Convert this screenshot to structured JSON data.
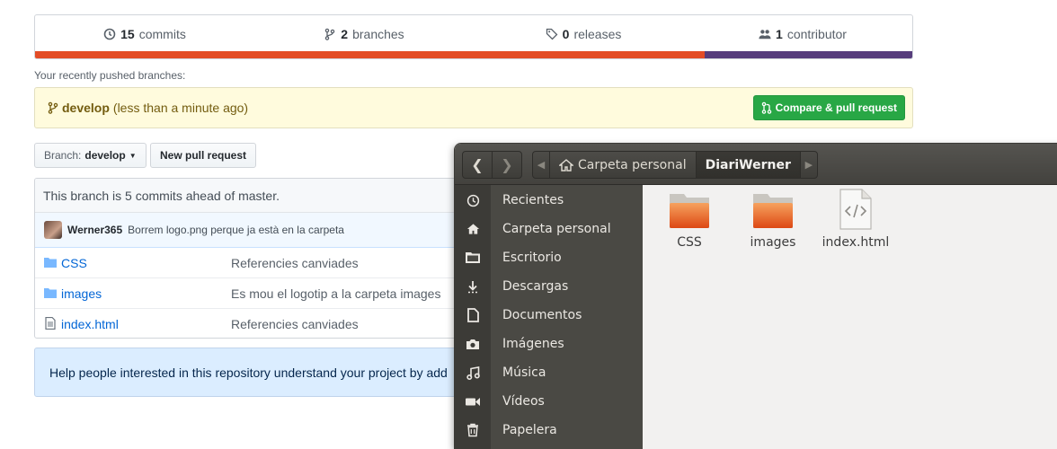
{
  "github": {
    "summary": {
      "commits": {
        "count": "15",
        "label": "commits",
        "icon": "history-icon"
      },
      "branches": {
        "count": "2",
        "label": "branches",
        "icon": "branch-icon"
      },
      "releases": {
        "count": "0",
        "label": "releases",
        "icon": "tag-icon"
      },
      "contributors": {
        "count": "1",
        "label": "contributor",
        "icon": "people-icon"
      }
    },
    "language_bar": [
      {
        "color": "#e34c26",
        "fraction": 0.763
      },
      {
        "color": "#563d7c",
        "fraction": 0.237
      }
    ],
    "recent_label": "Your recently pushed branches:",
    "recent_branch": {
      "name": "develop",
      "time": "(less than a minute ago)"
    },
    "compare_button": "Compare & pull request",
    "branch_button": {
      "prefix": "Branch:",
      "value": "develop"
    },
    "new_pr_button": "New pull request",
    "ahead_text": "This branch is 5 commits ahead of master.",
    "latest_commit": {
      "author": "Werner365",
      "message": "Borrem logo.png perque ja està en la carpeta"
    },
    "files": [
      {
        "name": "CSS",
        "type": "folder",
        "message": "Referencies canviades"
      },
      {
        "name": "images",
        "type": "folder",
        "message": "Es mou el logotip a la carpeta images"
      },
      {
        "name": "index.html",
        "type": "file",
        "message": "Referencies canviades"
      }
    ],
    "help_text": "Help people interested in this repository understand your project by add"
  },
  "nautilus": {
    "path": [
      {
        "label": "Carpeta personal",
        "icon": "home-icon"
      },
      {
        "label": "DiariWerner",
        "active": true
      }
    ],
    "sidebar": [
      {
        "label": "Recientes",
        "icon": "clock-icon"
      },
      {
        "label": "Carpeta personal",
        "icon": "home-icon"
      },
      {
        "label": "Escritorio",
        "icon": "desktop-folder-icon"
      },
      {
        "label": "Descargas",
        "icon": "download-icon"
      },
      {
        "label": "Documentos",
        "icon": "document-icon"
      },
      {
        "label": "Imágenes",
        "icon": "camera-icon"
      },
      {
        "label": "Música",
        "icon": "music-icon"
      },
      {
        "label": "Vídeos",
        "icon": "video-icon"
      },
      {
        "label": "Papelera",
        "icon": "trash-icon"
      }
    ],
    "items": [
      {
        "label": "CSS",
        "type": "folder"
      },
      {
        "label": "images",
        "type": "folder"
      },
      {
        "label": "index.html",
        "type": "html-file"
      }
    ],
    "colors": {
      "folder": "#e25a1c",
      "sidebar": "#4a4944",
      "titlebar": "#4b4a46"
    }
  }
}
